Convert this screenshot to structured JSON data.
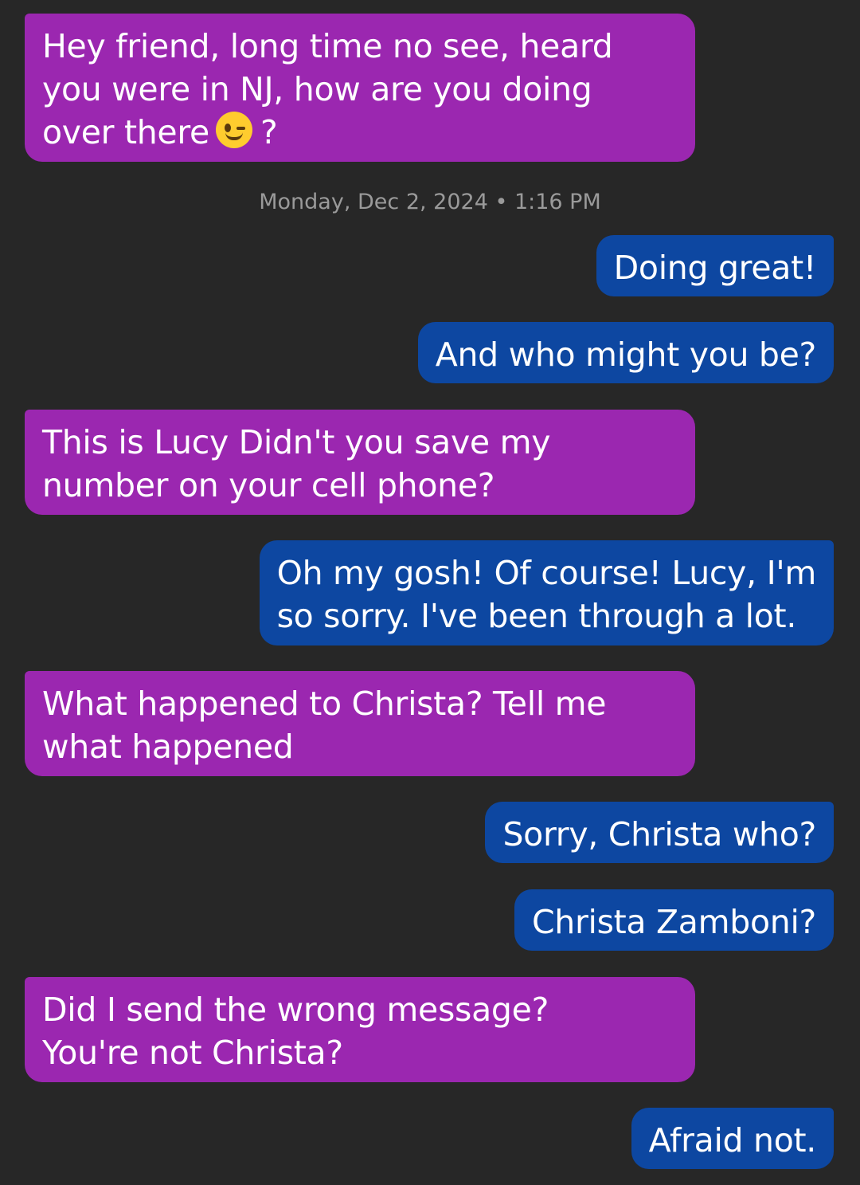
{
  "conversation": {
    "timestamp": "Monday, Dec 2, 2024 • 1:16 PM",
    "messages": [
      {
        "direction": "incoming",
        "lines": [
          "Hey friend, long time no see, heard",
          "you were in NJ, how are you doing",
          "over there",
          "?"
        ],
        "emoji": "winking-face-icon"
      },
      {
        "direction": "outgoing",
        "lines": [
          "Doing great!"
        ]
      },
      {
        "direction": "outgoing",
        "lines": [
          "And who might you be?"
        ]
      },
      {
        "direction": "incoming",
        "lines": [
          "This is Lucy Didn't you save my",
          "number on your cell phone?"
        ]
      },
      {
        "direction": "outgoing",
        "lines": [
          "Oh my gosh!  Of course!  Lucy, I'm",
          "so sorry.  I've been through a lot."
        ]
      },
      {
        "direction": "incoming",
        "lines": [
          "What happened to Christa? Tell me",
          "what happened"
        ]
      },
      {
        "direction": "outgoing",
        "lines": [
          "Sorry, Christa who?"
        ]
      },
      {
        "direction": "outgoing",
        "lines": [
          "Christa Zamboni?"
        ]
      },
      {
        "direction": "incoming",
        "lines": [
          "Did I send the wrong message?",
          "You're not Christa?"
        ]
      },
      {
        "direction": "outgoing",
        "lines": [
          "Afraid not."
        ]
      }
    ]
  },
  "colors": {
    "background": "#272727",
    "incoming_bubble": "#9b27b0",
    "outgoing_bubble": "#0d47a1",
    "text": "#ffffff",
    "timestamp_text": "#9a9a9a"
  }
}
